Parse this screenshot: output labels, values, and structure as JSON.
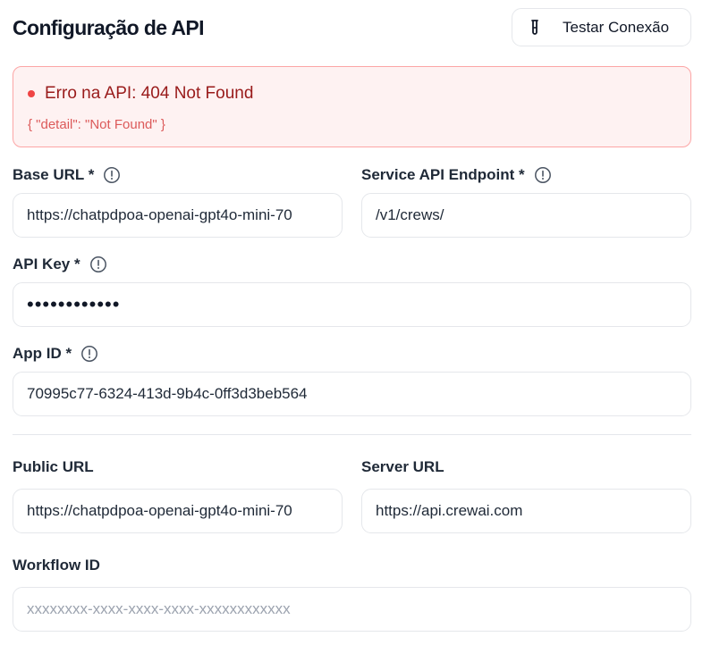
{
  "header": {
    "title": "Configuração de API",
    "test_button_label": "Testar Conexão",
    "test_button_icon": "test-tube-icon"
  },
  "error": {
    "title": "Erro na API: 404 Not Found",
    "detail": "{ \"detail\": \"Not Found\" }",
    "color": "#ef4444"
  },
  "fields": {
    "base_url": {
      "label": "Base URL *",
      "value": "https://chatpdpoa-openai-gpt4o-mini-70"
    },
    "service_endpoint": {
      "label": "Service API Endpoint *",
      "value": "/v1/crews/"
    },
    "api_key": {
      "label": "API Key *",
      "value": "••••••••••••"
    },
    "app_id": {
      "label": "App ID *",
      "value": "70995c77-6324-413d-9b4c-0ff3d3beb564"
    },
    "public_url": {
      "label": "Public URL",
      "value": "https://chatpdpoa-openai-gpt4o-mini-70"
    },
    "server_url": {
      "label": "Server URL",
      "value": "https://api.crewai.com"
    },
    "workflow_id": {
      "label": "Workflow ID",
      "placeholder": "xxxxxxxx-xxxx-xxxx-xxxx-xxxxxxxxxxxx"
    }
  }
}
